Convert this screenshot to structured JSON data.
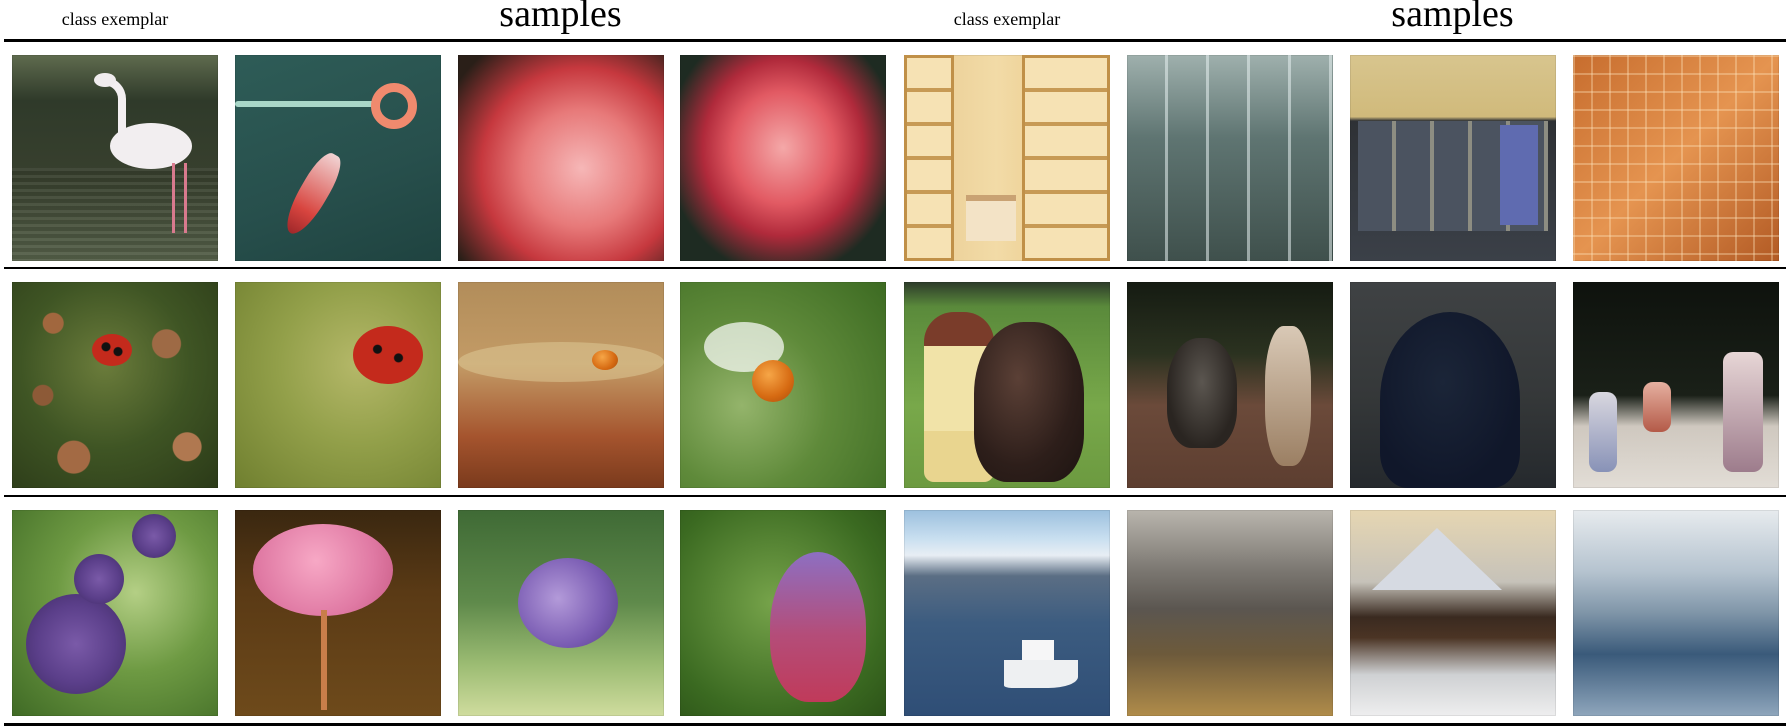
{
  "headers": {
    "left_exemplar": "class exemplar",
    "left_samples": "samples",
    "right_exemplar": "class exemplar",
    "right_samples": "samples"
  }
}
